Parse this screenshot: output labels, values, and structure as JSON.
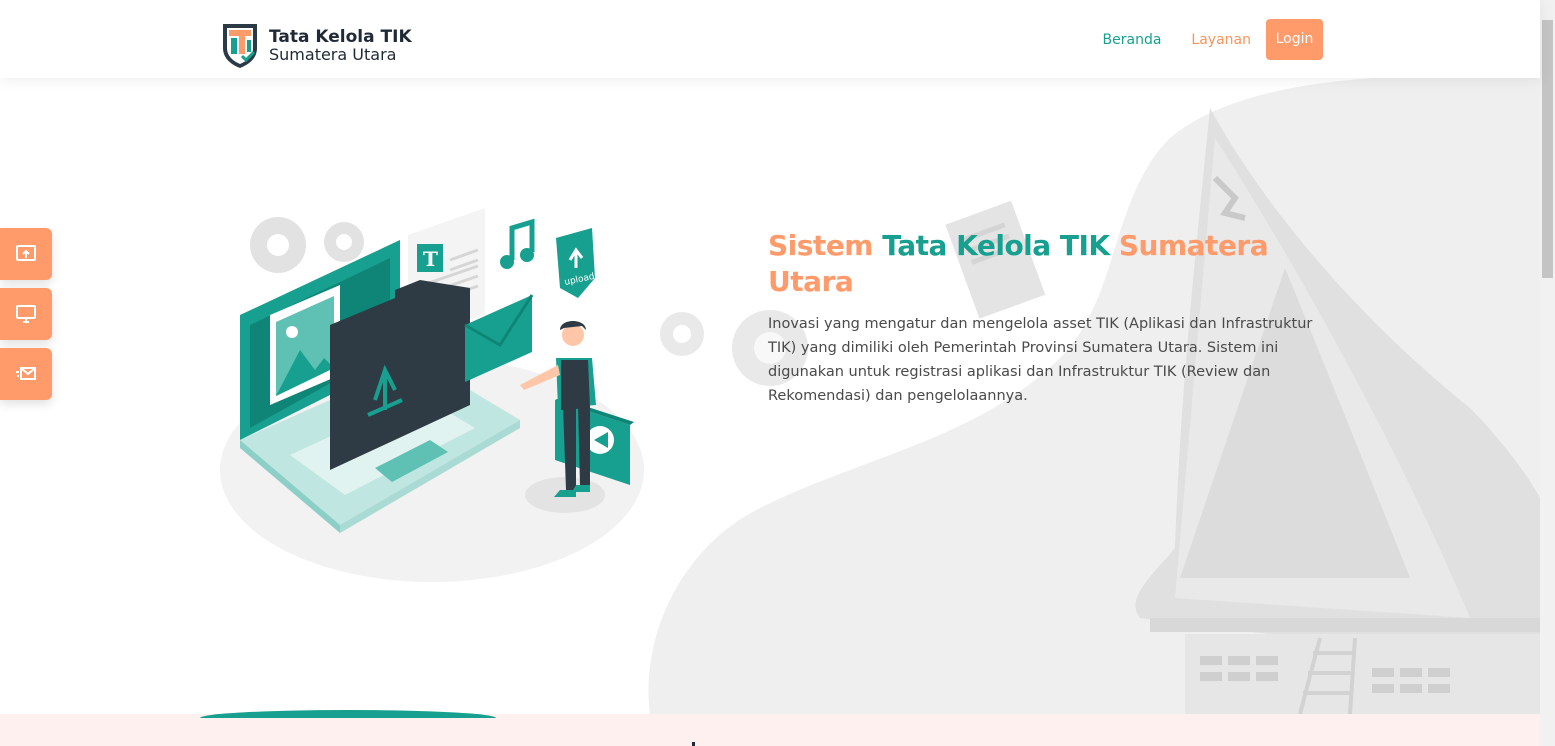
{
  "header": {
    "brand_title": "Tata Kelola TIK",
    "brand_subtitle": "Sumatera Utara",
    "nav": {
      "beranda": "Beranda",
      "layanan": "Layanan",
      "login": "Login"
    }
  },
  "hero": {
    "title_part1": "Sistem",
    "title_part2": "Tata Kelola TIK",
    "title_part3": "Sumatera Utara",
    "description": "Inovasi yang mengatur dan mengelola asset TIK (Aplikasi dan Infrastruktur TIK) yang dimiliki oleh Pemerintah Provinsi Sumatera Utara. Sistem ini digunakan untuk registrasi aplikasi dan Infrastruktur TIK (Review dan Rekomendasi) dan pengelolaannya.",
    "illustration_label": "upload"
  },
  "side_buttons": [
    {
      "icon": "upload-screen-icon"
    },
    {
      "icon": "monitor-icon"
    },
    {
      "icon": "mail-fast-icon"
    }
  ],
  "colors": {
    "accent_orange": "#ff9a6a",
    "accent_teal": "#17a08f",
    "dark": "#1f2a36",
    "bottom_bg": "#fdf0ee"
  }
}
